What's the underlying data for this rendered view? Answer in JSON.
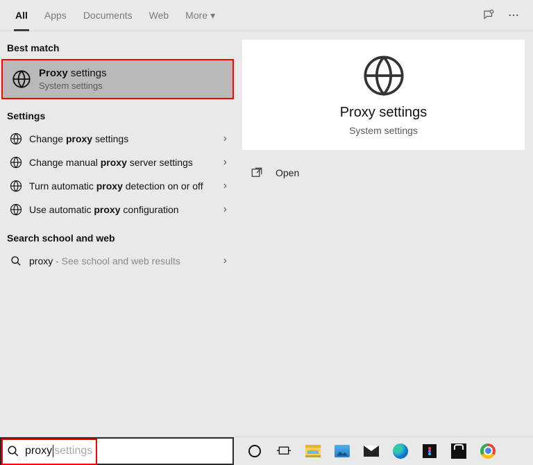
{
  "tabs": {
    "all": "All",
    "apps": "Apps",
    "documents": "Documents",
    "web": "Web",
    "more": "More"
  },
  "sections": {
    "best": "Best match",
    "settings": "Settings",
    "school": "Search school and web"
  },
  "bestmatch": {
    "t1": "Proxy",
    "t2": " settings",
    "sub": "System settings"
  },
  "settingsRows": {
    "r0a": "Change ",
    "r0b": "proxy",
    "r0c": " settings",
    "r1a": "Change manual ",
    "r1b": "proxy",
    "r1c": " server settings",
    "r2a": "Turn automatic ",
    "r2b": "proxy",
    "r2c": " detection on or off",
    "r3a": "Use automatic ",
    "r3b": "proxy",
    "r3c": " configuration"
  },
  "webRow": {
    "term": "proxy",
    "hint": " - See school and web results"
  },
  "detail": {
    "title": "Proxy settings",
    "sub": "System settings",
    "open": "Open"
  },
  "search": {
    "typed": "proxy",
    "ghost": " settings"
  }
}
